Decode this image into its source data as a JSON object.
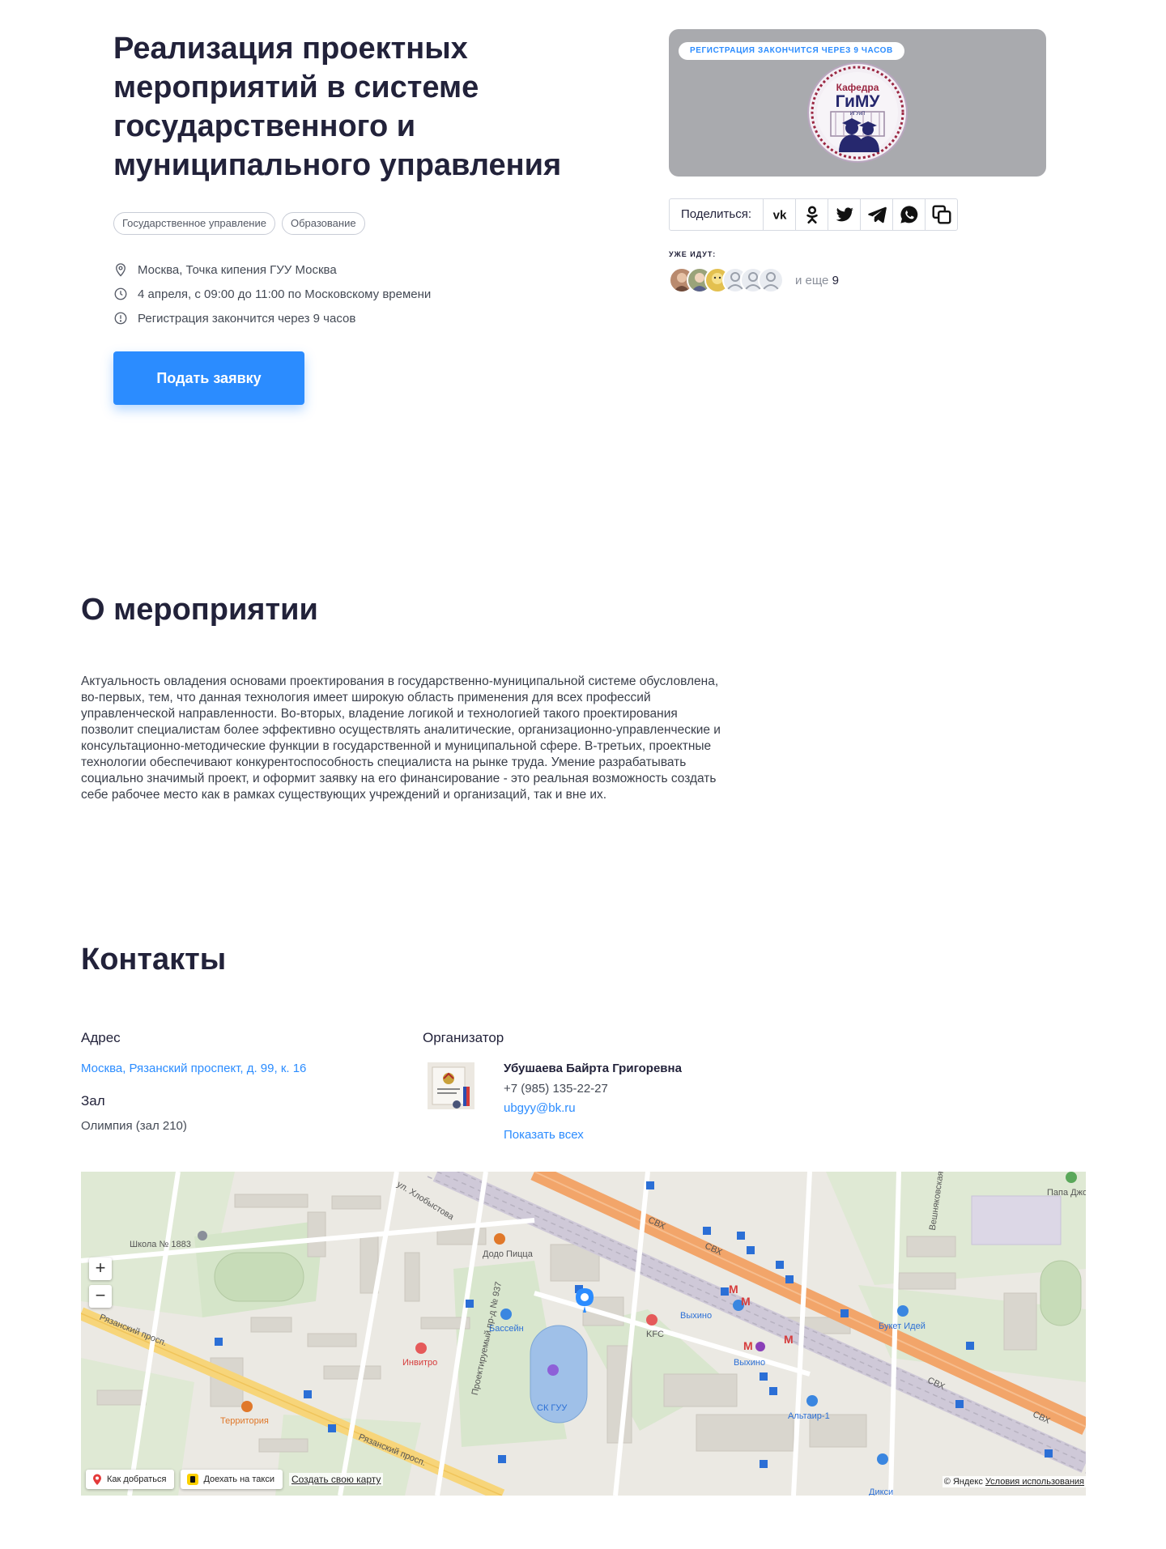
{
  "event": {
    "title": "Реализация проектных мероприятий в системе государственного и муниципального управления",
    "tags": [
      "Государственное управление",
      "Образование"
    ],
    "location": "Москва, Точка кипения ГУУ Москва",
    "datetime": "4 апреля, с 09:00 до 11:00 по Московскому времени",
    "registration_note": "Регистрация закончится через 9 часов",
    "apply_label": "Подать заявку"
  },
  "cover": {
    "badge": "РЕГИСТРАЦИЯ ЗАКОНЧИТСЯ ЧЕРЕЗ 9 ЧАСОВ",
    "logo_line1": "Кафедра",
    "logo_line2": "ГиМУ",
    "logo_line3": "ИГУиП"
  },
  "share": {
    "label": "Поделиться:",
    "icons": [
      "vk-icon",
      "odnoklassniki-icon",
      "twitter-icon",
      "telegram-icon",
      "whatsapp-icon",
      "copy-icon"
    ]
  },
  "going": {
    "label": "УЖЕ ИДУТ:",
    "more_prefix": "и еще",
    "more_count": "9"
  },
  "about": {
    "title": "О мероприятии",
    "text": "Актуальность овладения основами проектирования в государственно-муниципальной системе обусловлена, во-первых, тем, что данная технология имеет широкую область применения для всех профессий управленческой направленности. Во-вторых, владение логикой и технологией такого проектирования позволит специалистам более эффективно осуществлять аналитические, организационно-управленческие и консультационно-методические функции в государственной и муниципальной сфере. В-третьих, проектные технологии обеспечивают конкурентоспособность специалиста на рынке труда. Умение разрабатывать социально значимый проект, и оформит заявку на его финансирование - это реальная возможность создать себе рабочее место как в рамках существующих учреждений и организаций, так и вне их."
  },
  "contacts": {
    "title": "Контакты",
    "address_label": "Адрес",
    "address_value": "Москва, Рязанский проспект, д. 99, к. 16",
    "hall_label": "Зал",
    "hall_value": "Олимпия (зал 210)",
    "organizer_label": "Организатор",
    "organizer_name": "Убушаева Байрта Григоревна",
    "organizer_phone": "+7 (985) 135-22-27",
    "organizer_email": "ubgyy@bk.ru",
    "show_all": "Показать всех"
  },
  "map": {
    "route_label": "Как добраться",
    "taxi_label": "Доехать на такси",
    "create_label": "Создать свою карту",
    "copyright": "© Яндекс",
    "terms": "Условия использования",
    "labels": {
      "school": "Школа № 1883",
      "dodo": "Додо Пицца",
      "pool": "Бассейн",
      "invitro": "Инвитро",
      "territory": "Территория",
      "skguu": "СК ГУУ",
      "kfc": "KFC",
      "vykhino1": "Выхино",
      "vykhino2": "Выхино",
      "buket": "Букет Идей",
      "altair": "Альтаир-1",
      "diksi": "Дикси",
      "papa": "Папа Джонс",
      "svx1": "СВХ",
      "svx2": "СВХ",
      "svx3": "СВХ",
      "svx4": "СВХ",
      "ryaz1": "Рязанский просп.",
      "ryaz2": "Рязанский просп.",
      "khlob": "ул. Хлобыстова",
      "proekt": "Проектируемый пр-д № 937",
      "veshn": "Вешняковская"
    }
  },
  "colors": {
    "accent": "#2b8cff",
    "text": "#22223a",
    "cover_bg": "#a9aaae",
    "road_orange": "#f2a56a",
    "road_yellow": "#f7d57a"
  }
}
